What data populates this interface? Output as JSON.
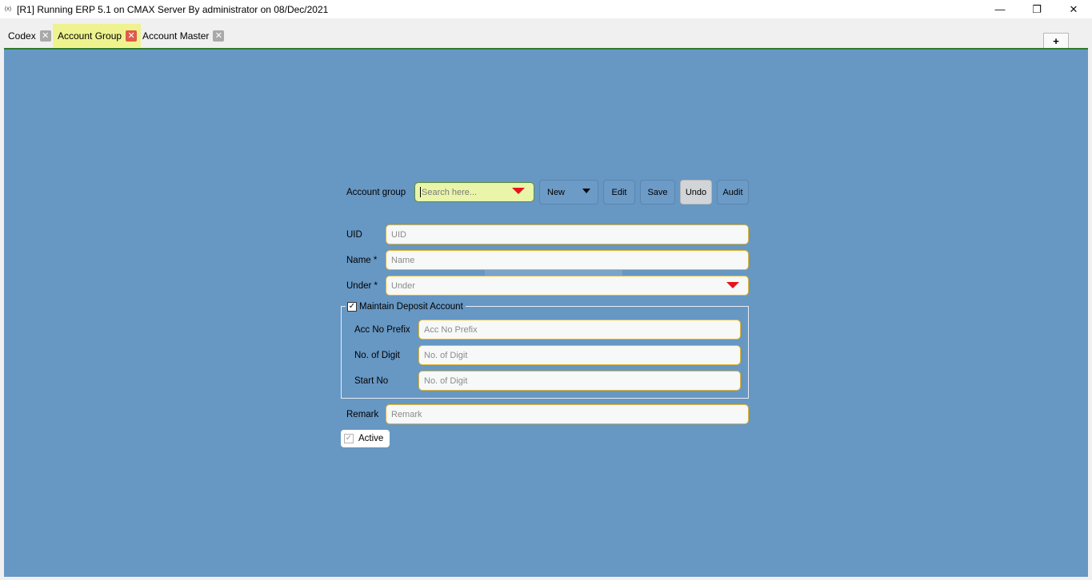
{
  "window": {
    "icon": "(x)",
    "title": "[R1] Running ERP 5.1 on CMAX Server By administrator on 08/Dec/2021",
    "minimize": "—",
    "restore": "❐",
    "close": "✕"
  },
  "tabs": [
    {
      "label": "Codex",
      "close": "✕"
    },
    {
      "label": "Account Group",
      "close": "✕"
    },
    {
      "label": "Account Master",
      "close": "✕"
    }
  ],
  "add_tab": "+",
  "toolbar": {
    "account_group_label": "Account group",
    "search_placeholder": "Search here...",
    "new_label": "New",
    "edit_label": "Edit",
    "save_label": "Save",
    "undo_label": "Undo",
    "audit_label": "Audit"
  },
  "form": {
    "uid_label": "UID",
    "uid_placeholder": "UID",
    "name_label": "Name *",
    "name_placeholder": "Name",
    "under_label": "Under *",
    "under_placeholder": "Under",
    "deposit": {
      "legend": "Maintain Deposit Account",
      "checked": "✓",
      "acc_prefix_label": "Acc No Prefix",
      "acc_prefix_placeholder": "Acc No Prefix",
      "digits_label": "No. of Digit",
      "digits_placeholder": "No. of Digit",
      "start_label": "Start No",
      "start_placeholder": "No. of Digit"
    },
    "remark_label": "Remark",
    "remark_placeholder": "Remark",
    "active_label": "Active",
    "active_checked": "✓"
  },
  "colors": {
    "background": "#6797c3",
    "field_border": "#e4b52c",
    "search_bg": "#e9f5a8",
    "active_tab": "#eef38f",
    "arrow": "#e3151b"
  }
}
